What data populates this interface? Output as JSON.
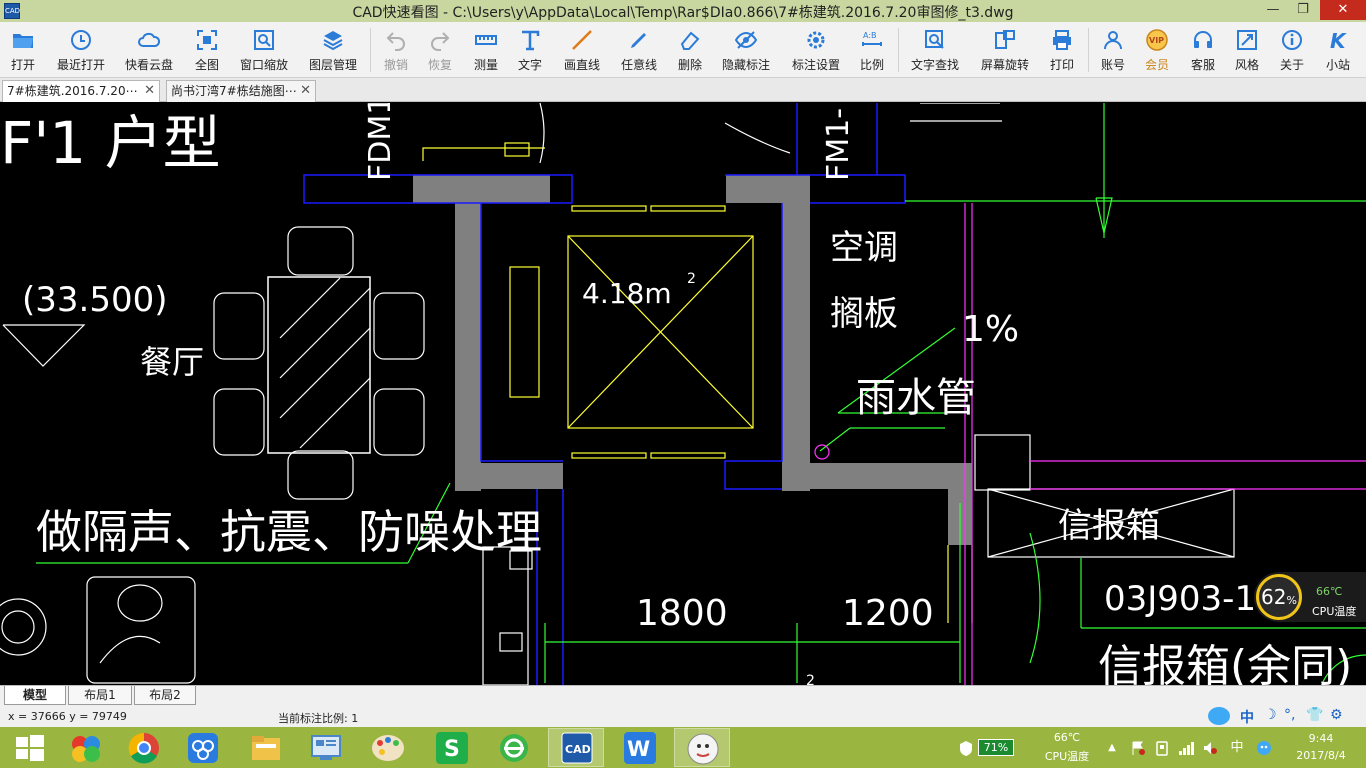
{
  "window": {
    "title": "CAD快速看图 - C:\\Users\\y\\AppData\\Local\\Temp\\Rar$DIa0.866\\7#栋建筑.2016.7.20审图修_t3.dwg",
    "app_icon": "CAD",
    "minimize": "—",
    "maximize": "❐",
    "close": "✕"
  },
  "toolbar": {
    "items": [
      {
        "label": "打开",
        "icon": "folder-open-icon"
      },
      {
        "label": "最近打开",
        "icon": "history-icon"
      },
      {
        "label": "快看云盘",
        "icon": "cloud-icon"
      },
      {
        "label": "全图",
        "icon": "fit-icon"
      },
      {
        "label": "窗口缩放",
        "icon": "zoom-window-icon"
      },
      {
        "label": "图层管理",
        "icon": "layers-icon"
      },
      {
        "label": "撤销",
        "icon": "undo-icon"
      },
      {
        "label": "恢复",
        "icon": "redo-icon"
      },
      {
        "label": "测量",
        "icon": "ruler-icon"
      },
      {
        "label": "文字",
        "icon": "text-icon"
      },
      {
        "label": "画直线",
        "icon": "line-icon"
      },
      {
        "label": "任意线",
        "icon": "freehand-icon"
      },
      {
        "label": "删除",
        "icon": "eraser-icon"
      },
      {
        "label": "隐藏标注",
        "icon": "eye-hide-icon"
      },
      {
        "label": "标注设置",
        "icon": "annotation-settings-icon"
      },
      {
        "label": "比例",
        "icon": "scale-icon"
      },
      {
        "label": "文字查找",
        "icon": "text-search-icon"
      },
      {
        "label": "屏幕旋转",
        "icon": "rotate-screen-icon"
      },
      {
        "label": "打印",
        "icon": "printer-icon"
      },
      {
        "label": "账号",
        "icon": "user-icon"
      },
      {
        "label": "会员",
        "icon": "vip-icon"
      },
      {
        "label": "客服",
        "icon": "headset-icon"
      },
      {
        "label": "风格",
        "icon": "style-icon"
      },
      {
        "label": "关于",
        "icon": "info-icon"
      },
      {
        "label": "小站",
        "icon": "site-icon"
      }
    ]
  },
  "tabs": [
    {
      "label": "7#栋建筑.2016.7.20⋯",
      "close": "✕"
    },
    {
      "label": "尚书汀湾7#栋结施图⋯",
      "close": "✕"
    }
  ],
  "drawing": {
    "texts": {
      "unit_type": "F'1 户型",
      "elevation": "(33.500)",
      "dining": "餐厅",
      "area": "4.18m",
      "area_sup": "2",
      "ac": "空调",
      "shelf": "搁板",
      "slope": "1%",
      "rain_pipe": "雨水管",
      "note": "做隔声、抗震、防噪处理",
      "mailbox": "信报箱",
      "std_code": "03J903-1",
      "mailbox_note": "信报箱(余同)",
      "dim1": "1800",
      "dim2": "1200",
      "fdm": "FDM1",
      "fm": "FM1-",
      "bottom_sup": "2"
    },
    "colors": {
      "wall": "#808080",
      "yellow": "#ffff33",
      "blue": "#1a1aff",
      "green": "#33ff33",
      "magenta": "#ff33ff",
      "white": "#ffffff"
    }
  },
  "layout_tabs": [
    "模型",
    "布局1",
    "布局2"
  ],
  "status": {
    "coords": "x = 37666  y = 79749",
    "scale": "当前标注比例: 1"
  },
  "gauge": {
    "percent": "62",
    "unit": "%",
    "temp": "66℃",
    "label": "CPU温度"
  },
  "ime": {
    "items": [
      "中",
      "☽",
      "°,",
      "👕",
      "⚙"
    ]
  },
  "taskbar": {
    "apps": [
      "start-icon",
      "game-icon",
      "chrome-icon",
      "baidu-cloud-icon",
      "file-explorer-icon",
      "control-panel-icon",
      "paint-icon",
      "wps-spreadsheet-icon",
      "ie-icon",
      "cad-icon",
      "wps-writer-icon",
      "avatar-app-icon"
    ],
    "battery": "71%",
    "temp": "66℃",
    "temp_label": "CPU温度",
    "ime": "中",
    "time": "9:44",
    "date": "2017/8/4"
  }
}
